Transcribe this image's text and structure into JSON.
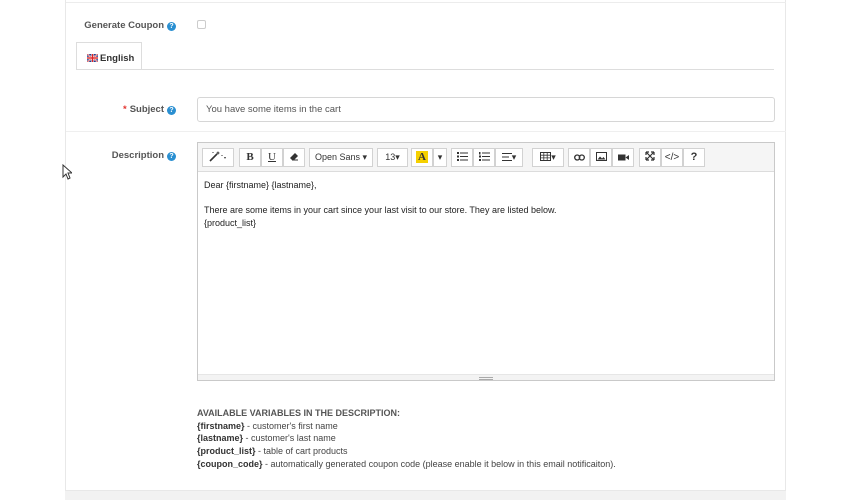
{
  "form": {
    "generate_coupon_label": "Generate Coupon",
    "help_glyph": "?",
    "required_mark": "*",
    "generate_coupon_checked": false,
    "language_tab": "English",
    "subject_label": "Subject",
    "subject_value": "You have some items in the cart",
    "description_label": "Description"
  },
  "toolbar": {
    "font_family": "Open Sans",
    "font_size": "13",
    "bold": "B",
    "underline": "U",
    "color_letter": "A",
    "help": "?"
  },
  "editor": {
    "lines": [
      "Dear {firstname} {lastname},",
      "",
      "There are some items in your cart since your last visit to our store. They are listed below.",
      "{product_list}"
    ]
  },
  "variables": {
    "heading": "AVAILABLE VARIABLES IN THE DESCRIPTION:",
    "items": [
      {
        "name": "{firstname}",
        "desc": " - customer's first name"
      },
      {
        "name": "{lastname}",
        "desc": " - customer's last name"
      },
      {
        "name": "{product_list}",
        "desc": " - table of cart products"
      },
      {
        "name": "{coupon_code}",
        "desc": " - automatically generated coupon code (please enable it below in this email notificaiton)."
      }
    ]
  },
  "colors": {
    "help_blue": "#2a8fd1",
    "required_red": "#e3342f",
    "highlight_yellow": "#f5d000"
  },
  "icons": [
    "magic-wand-icon",
    "eraser-icon",
    "caret-down-icon",
    "unordered-list-icon",
    "ordered-list-icon",
    "align-icon",
    "table-icon",
    "link-icon",
    "picture-icon",
    "video-icon",
    "fullscreen-icon",
    "code-view-icon",
    "help-icon",
    "uk-flag-icon",
    "mouse-cursor-icon"
  ]
}
